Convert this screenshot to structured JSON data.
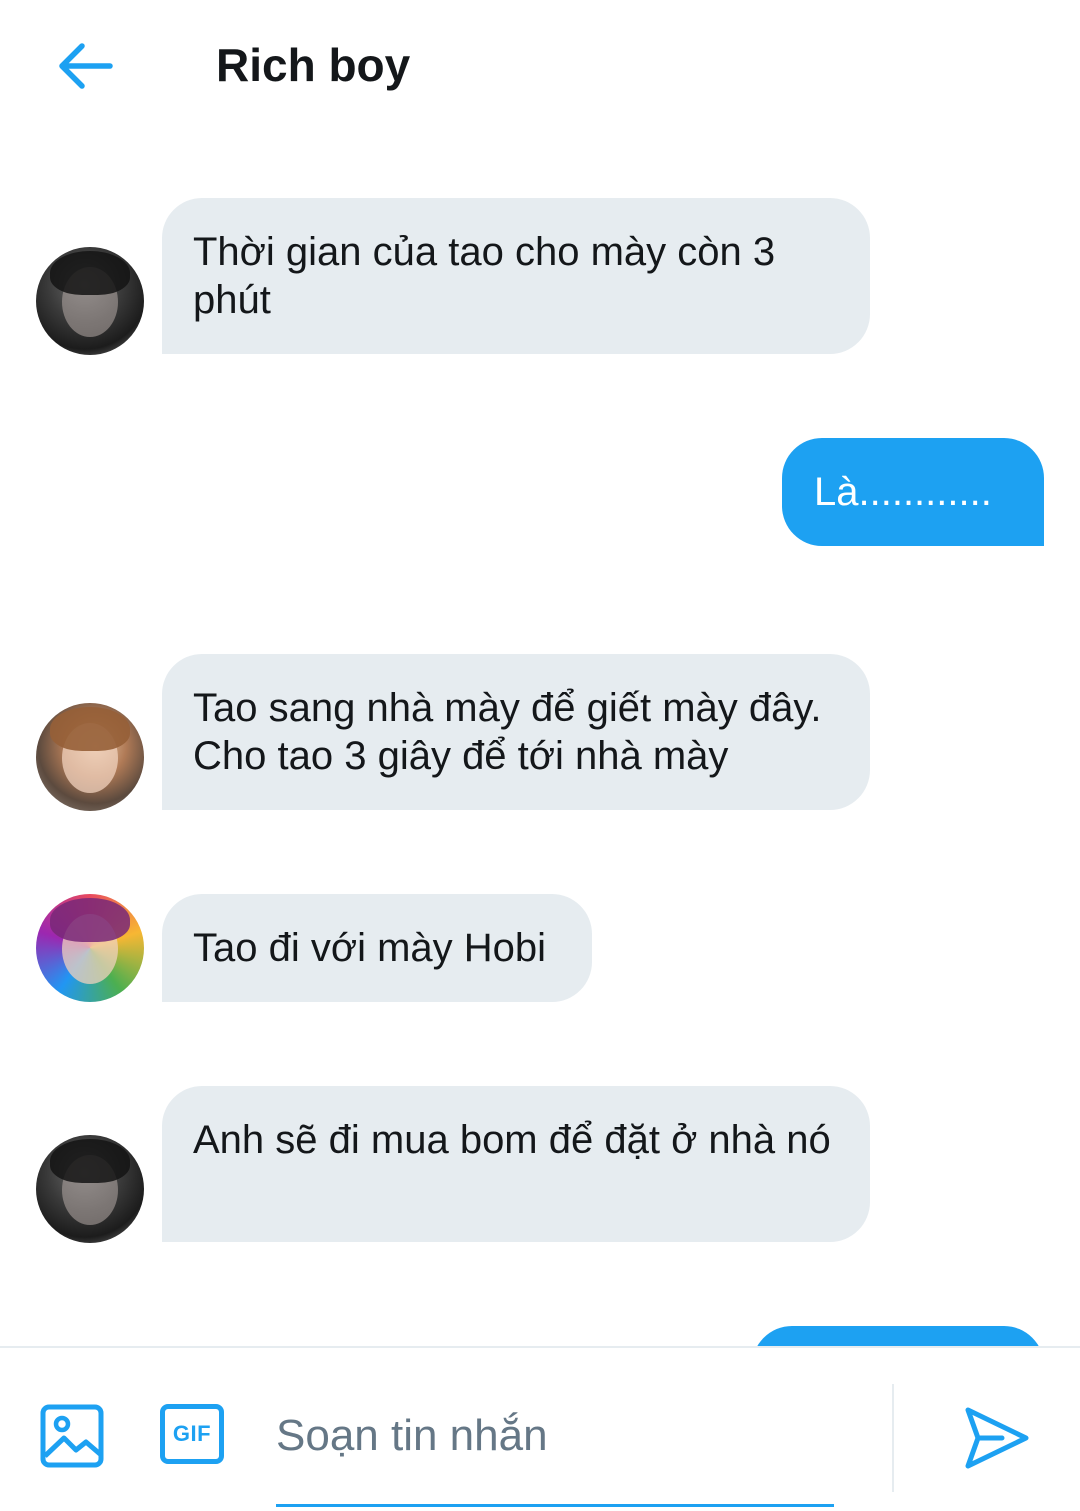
{
  "header": {
    "title": "Rich boy",
    "back_icon": "arrow-left-icon",
    "accent": "#1da1f2"
  },
  "messages": [
    {
      "direction": "incoming",
      "avatar": "avatar-dark-haired",
      "text": "Thời gian của tao cho mày còn 3 phút"
    },
    {
      "direction": "outgoing",
      "text": "Là............"
    },
    {
      "direction": "incoming",
      "avatar": "avatar-light-haired",
      "text": "Tao sang nhà mày để giết mày đây. Cho tao 3 giây để tới nhà mày"
    },
    {
      "direction": "incoming",
      "avatar": "avatar-colorful",
      "text": "Tao đi với mày Hobi"
    },
    {
      "direction": "incoming",
      "avatar": "avatar-dark-haired",
      "text": "Anh sẽ đi mua bom để đặt ở nhà nó"
    }
  ],
  "composer": {
    "placeholder": "Soạn tin nhắn",
    "value": "",
    "gif_label": "GIF",
    "media_icon": "image-icon",
    "send_icon": "send-icon"
  },
  "colors": {
    "incoming_bubble": "#e6ecf0",
    "outgoing_bubble": "#1da1f2",
    "placeholder": "#657786"
  }
}
